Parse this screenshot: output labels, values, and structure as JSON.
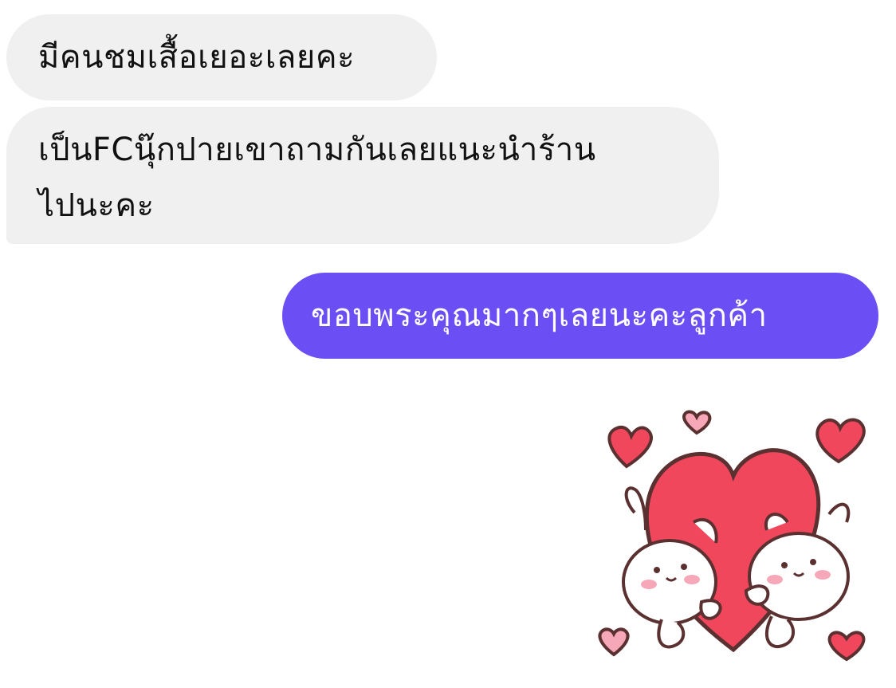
{
  "messages": [
    {
      "direction": "incoming",
      "text": "มีคนชมเสื้อเยอะเลยคะ"
    },
    {
      "direction": "incoming",
      "text": "เป็นFCนุ๊กปายเขาถามกันเลยแนะนำร้าน\nไปนะคะ"
    },
    {
      "direction": "outgoing",
      "text": "ขอบพระคุณมากๆเลยนะคะลูกค้า"
    }
  ],
  "sticker": {
    "description_icon": "hearts-bunnies-sticker"
  },
  "colors": {
    "incoming_bubble": "#f0f0f0",
    "outgoing_bubble": "#6c4ef5",
    "heart": "#f0475c",
    "small_heart_pink": "#f6a8b8"
  }
}
